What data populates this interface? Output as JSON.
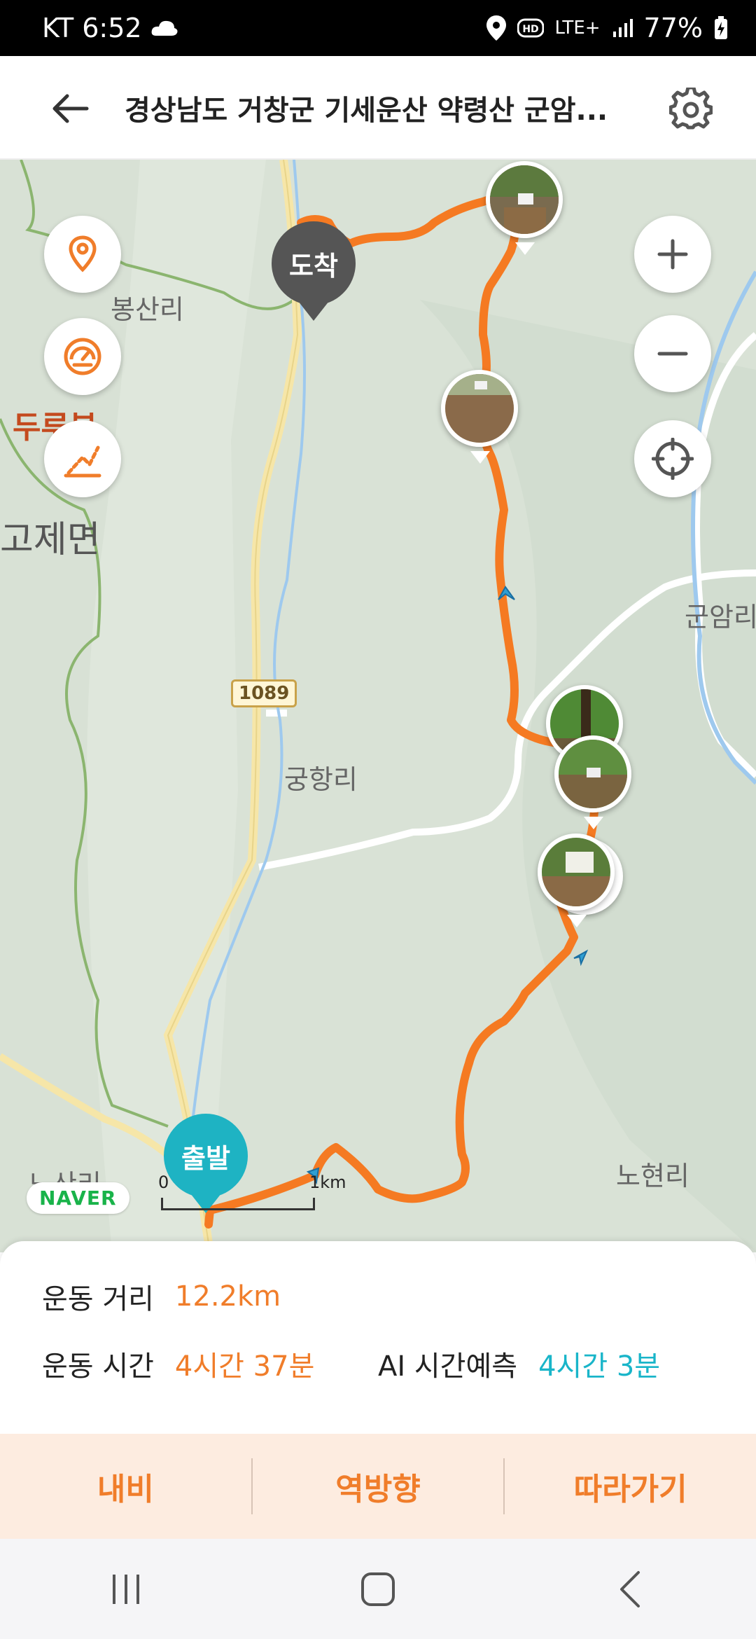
{
  "status_bar": {
    "carrier_time": "KT 6:52",
    "network": "LTE+",
    "battery": "77%"
  },
  "header": {
    "title": "경상남도 거창군 기세운산 약령산 군암..."
  },
  "map": {
    "labels": {
      "bongsanri": "봉산리",
      "durubong": "두루봉",
      "gojemyeon": "고제면",
      "gunamri": "군암리",
      "road_1089": "1089",
      "gunghangri": "궁항리",
      "nosanri": "노산리",
      "nohyeonri": "노현리"
    },
    "arrival_pin": "도착",
    "start_pin": "출발",
    "brand": "NAVER",
    "scale": {
      "zero": "0",
      "one": "1km"
    }
  },
  "stats": {
    "distance_label": "운동 거리",
    "distance_value": "12.2km",
    "time_label": "운동 시간",
    "time_value": "4시간 37분",
    "ai_label": "AI 시간예측",
    "ai_value": "4시간 3분"
  },
  "actions": {
    "navi": "내비",
    "reverse": "역방향",
    "follow": "따라가기"
  },
  "colors": {
    "route": "#f57a22",
    "accent": "#f07d2a",
    "teal": "#19b5c9",
    "arrival_pin": "#555555"
  }
}
